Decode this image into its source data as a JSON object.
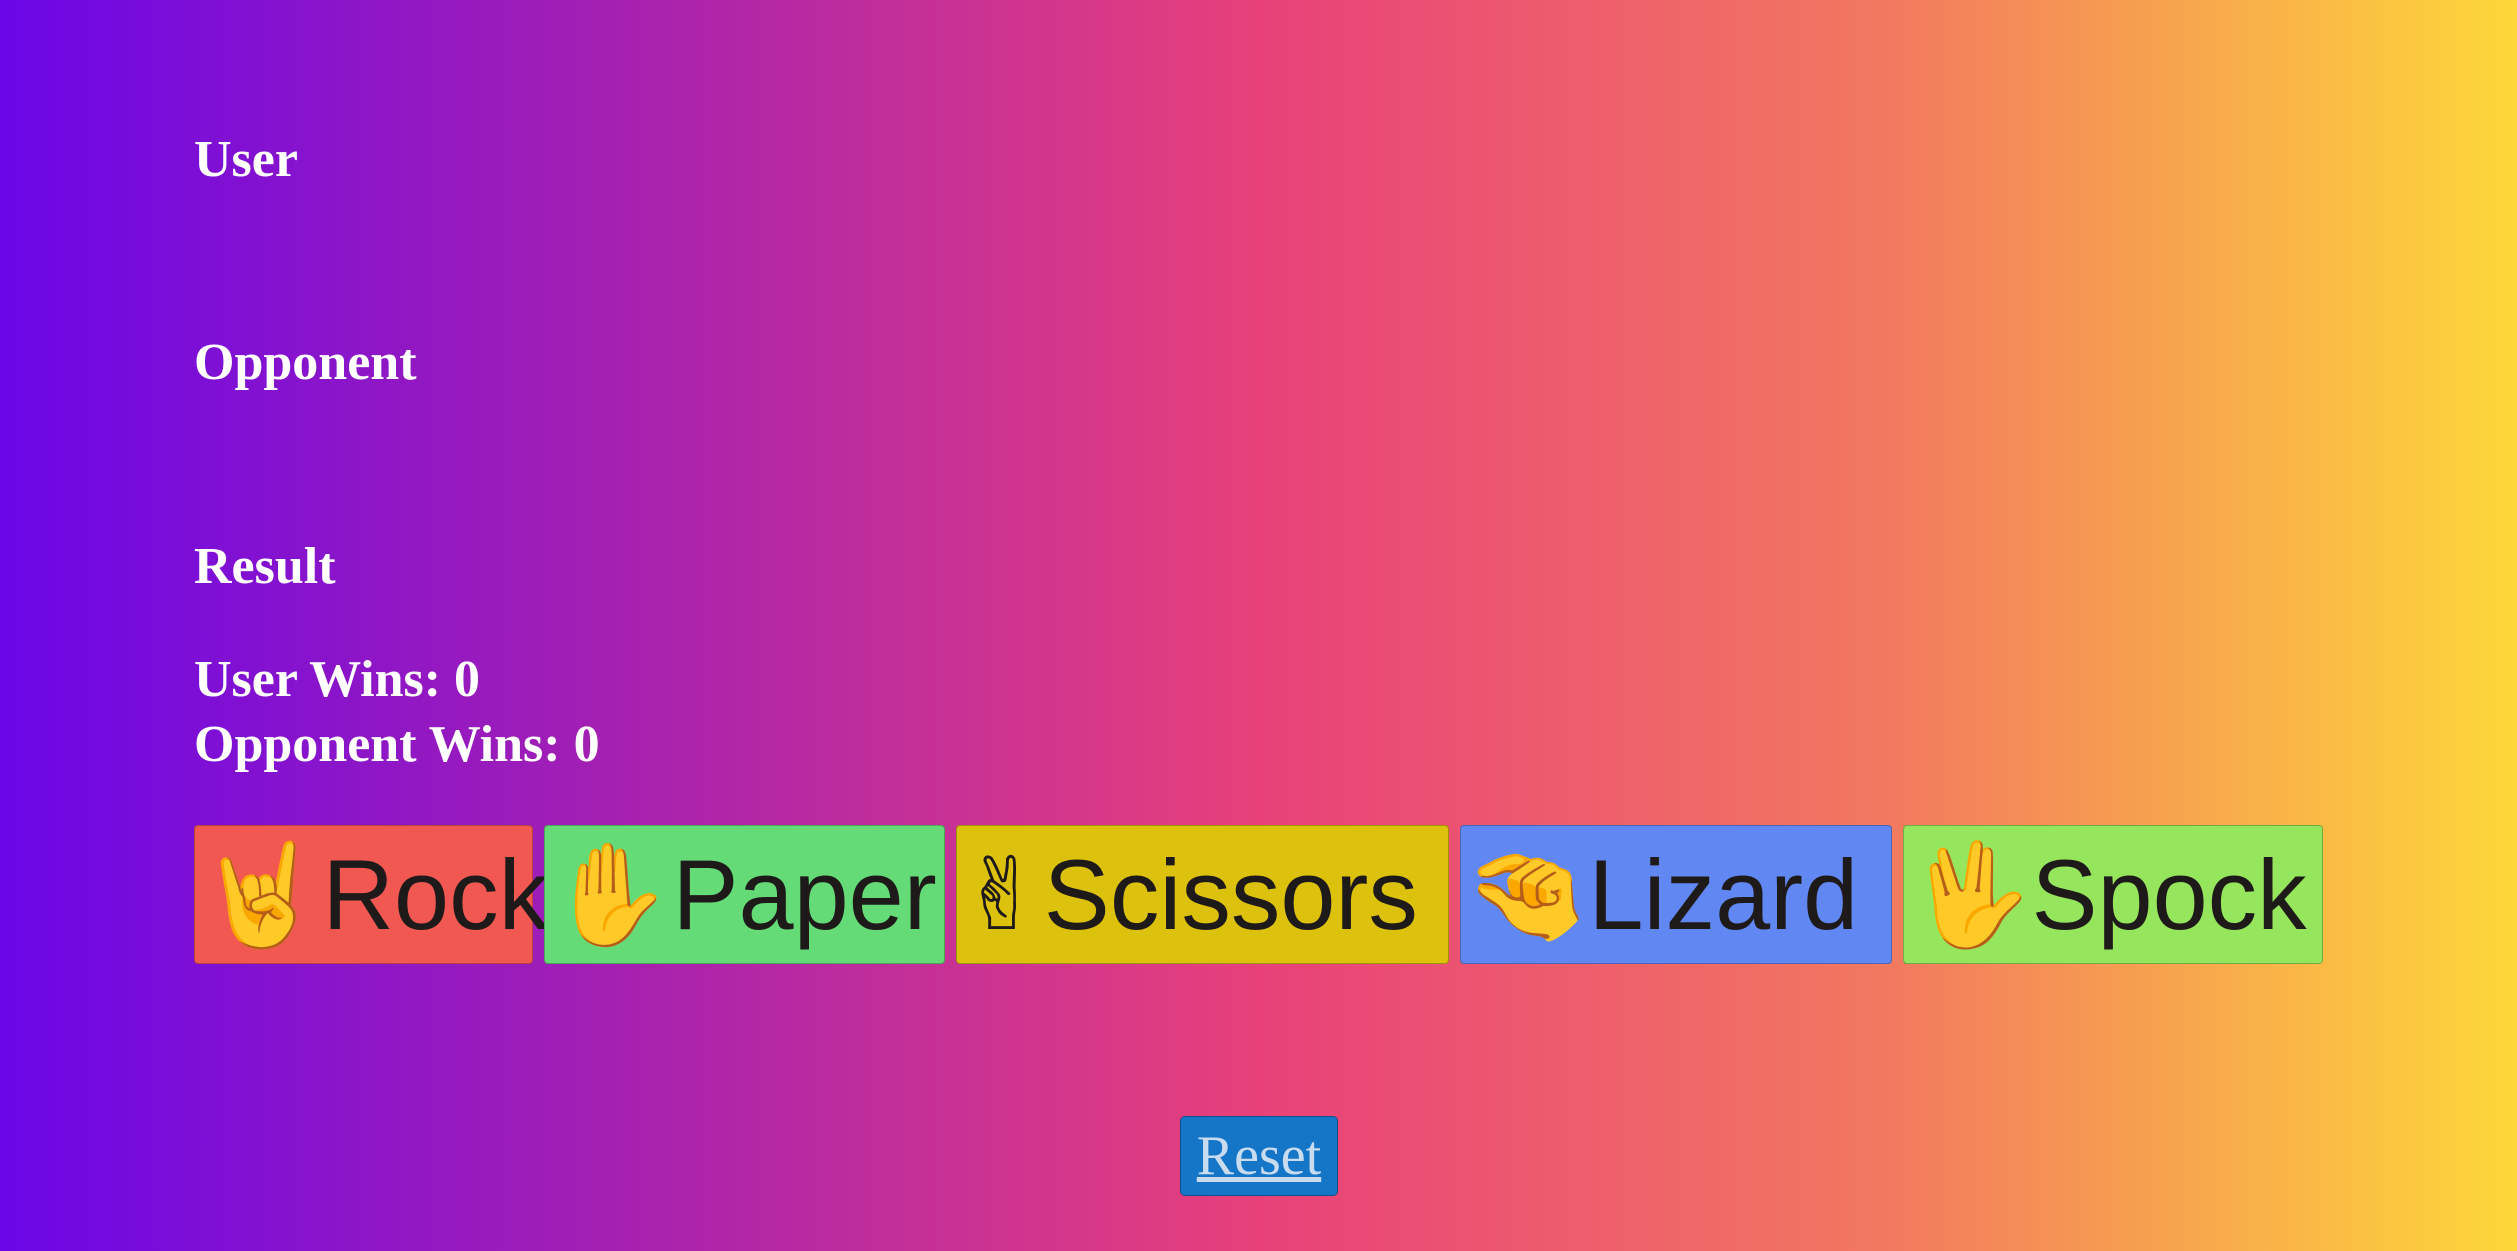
{
  "labels": {
    "user": "User",
    "opponent": "Opponent",
    "result": "Result"
  },
  "scores": {
    "user_wins": "User Wins: 0",
    "opponent_wins": "Opponent Wins: 0"
  },
  "choices": [
    {
      "label": "Rock",
      "emoji": "🤘",
      "icon": "rock-hand-icon",
      "color": "#f25852"
    },
    {
      "label": "Paper",
      "emoji": "✋",
      "icon": "raised-hand-icon",
      "color": "#64db77"
    },
    {
      "label": "Scissors",
      "emoji": "✌",
      "icon": "victory-hand-icon",
      "color": "#dcc20d"
    },
    {
      "label": "Lizard",
      "emoji": "🤏",
      "icon": "pinching-hand-icon",
      "color": "#6188f2"
    },
    {
      "label": "Spock",
      "emoji": "🖖",
      "icon": "vulcan-salute-icon",
      "color": "#95e65c"
    }
  ],
  "reset": {
    "label": "Reset",
    "color": "#1576c8"
  },
  "background": {
    "gradient": [
      "#6a06e7",
      "#e8417a",
      "#fdd839"
    ]
  }
}
